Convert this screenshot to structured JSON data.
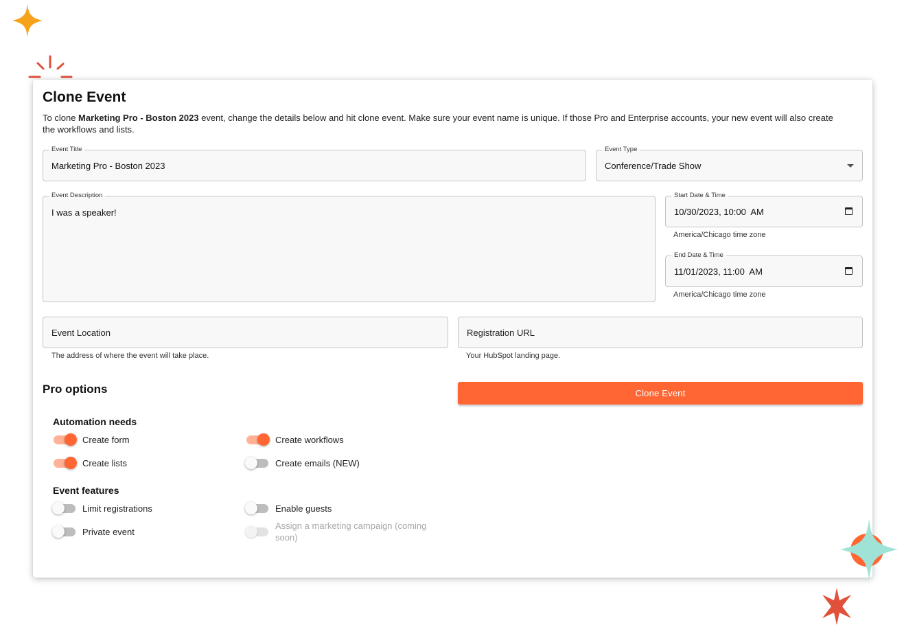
{
  "dialog": {
    "title": "Clone Event",
    "intro_prefix": "To clone ",
    "intro_event_name": "Marketing Pro - Boston 2023",
    "intro_suffix": " event, change the details below and hit clone event. Make sure your event name is unique. If those Pro and Enterprise accounts, your new event will also create the workflows and lists."
  },
  "form": {
    "event_title": {
      "label": "Event Title",
      "value": "Marketing Pro - Boston 2023"
    },
    "event_type": {
      "label": "Event Type",
      "value": "Conference/Trade Show"
    },
    "event_description": {
      "label": "Event Description",
      "value": "I was a speaker!"
    },
    "start": {
      "label": "Start Date & Time",
      "value": "10/30/2023, 10:00  AM",
      "helper": "America/Chicago time zone"
    },
    "end": {
      "label": "End Date & Time",
      "value": "11/01/2023, 11:00  AM",
      "helper": "America/Chicago time zone"
    },
    "location": {
      "placeholder": "Event Location",
      "helper": "The address of where the event will take place."
    },
    "registration_url": {
      "placeholder": "Registration URL",
      "helper": "Your HubSpot landing page."
    }
  },
  "pro_options": {
    "title": "Pro options",
    "clone_button": "Clone Event",
    "automation": {
      "title": "Automation needs",
      "items": [
        {
          "label": "Create form",
          "on": true
        },
        {
          "label": "Create workflows",
          "on": true
        },
        {
          "label": "Create lists",
          "on": true
        },
        {
          "label": "Create emails (NEW)",
          "on": false
        }
      ]
    },
    "features": {
      "title": "Event features",
      "items": [
        {
          "label": "Limit registrations",
          "on": false
        },
        {
          "label": "Enable guests",
          "on": false
        },
        {
          "label": "Private event",
          "on": false
        },
        {
          "label": "Assign a marketing campaign (coming soon)",
          "on": false,
          "disabled": true
        }
      ]
    }
  },
  "colors": {
    "accent": "#ff6633",
    "accent_light": "#ffb296",
    "teal_sparkle": "#9fe3d6",
    "yellow_sparkle": "#f7a21b",
    "red_sparkle": "#e0503a"
  },
  "icons": [
    "calendar-icon",
    "dropdown-arrow-icon",
    "sparkle-icon",
    "burst-icon"
  ]
}
